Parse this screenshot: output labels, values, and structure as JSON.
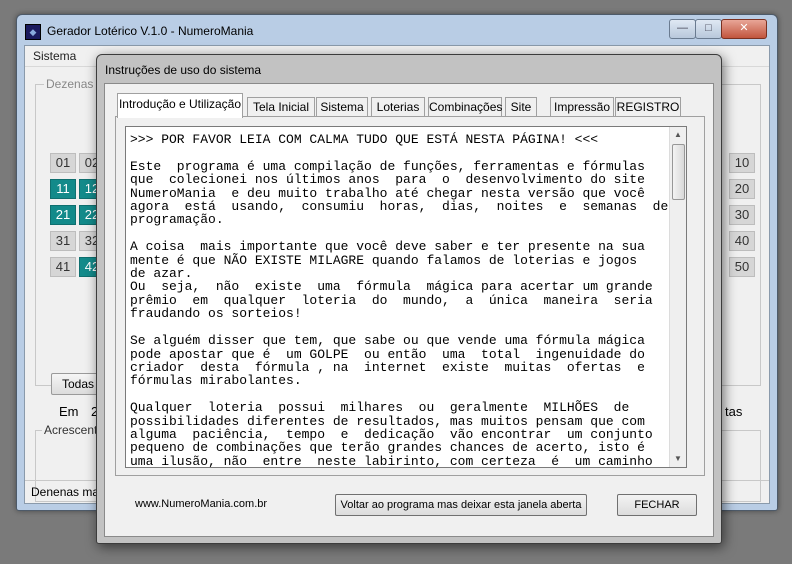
{
  "main_window": {
    "title": "Gerador Lotérico V.1.0 - NumeroMania",
    "menu": [
      "Sistema"
    ],
    "dezenas_label": "Dezenas p",
    "numbers_left": [
      {
        "n": "01",
        "sel": false
      },
      {
        "n": "02",
        "sel": false
      },
      {
        "n": "11",
        "sel": true
      },
      {
        "n": "12",
        "sel": true
      },
      {
        "n": "21",
        "sel": true
      },
      {
        "n": "22",
        "sel": true
      },
      {
        "n": "31",
        "sel": false
      },
      {
        "n": "32",
        "sel": false
      },
      {
        "n": "41",
        "sel": false
      },
      {
        "n": "42",
        "sel": true
      }
    ],
    "numbers_right": [
      {
        "n": "10",
        "sel": false
      },
      {
        "n": "20",
        "sel": false
      },
      {
        "n": "30",
        "sel": false
      },
      {
        "n": "40",
        "sel": false
      },
      {
        "n": "50",
        "sel": false
      }
    ],
    "todas_button": "Todas",
    "em_label": "Em",
    "em_value": "24",
    "right_partial_label": "tas",
    "acresc_label": "Acrescent",
    "status_text": "Denenas ma",
    "colors": {
      "selected": "#138a8a",
      "unselected": "#d6d6d6"
    }
  },
  "dialog": {
    "title": "Instruções de uso do sistema",
    "tabs": [
      "Introdução e Utilização",
      "Tela Inicial",
      "Sistema",
      "Loterias",
      "Combinações",
      "Site",
      "Impressão",
      "REGISTRO"
    ],
    "active_tab": 0,
    "text": ">>> POR FAVOR LEIA COM CALMA TUDO QUE ESTÁ NESTA PÁGINA! <<<\n\nEste  programa é uma compilação de funções, ferramentas e fórmulas\nque  colecionei nos últimos anos  para  o  desenvolvimento do site\nNumeroMania  e deu muito trabalho até chegar nesta versão que você\nagora  está  usando,  consumiu  horas,  dias,  noites  e  semanas  de\nprogramação.\n\nA coisa  mais importante que você deve saber e ter presente na sua\nmente é que NÃO EXISTE MILAGRE quando falamos de loterias e jogos\nde azar.\nOu  seja,  não  existe  uma  fórmula  mágica para acertar um grande\nprêmio  em  qualquer  loteria  do  mundo,  a  única  maneira  seria\nfraudando os sorteios!\n\nSe alguém disser que tem, que sabe ou que vende uma fórmula mágica\npode apostar que é  um GOLPE  ou então  uma  total  ingenuidade do\ncriador  desta  fórmula , na  internet  existe  muitas  ofertas  e\nfórmulas mirabolantes.\n\nQualquer  loteria  possui  milhares  ou  geralmente  MILHÕES  de\npossibilidades diferentes de resultados, mas muitos pensam que com\nalguma  paciência,  tempo  e  dedicação  vão encontrar  um conjunto\npequeno de combinações que terão grandes chances de acerto, isto é\numa ilusão, não  entre  neste labirinto, com certeza  é  um caminho",
    "site_url": "www.NumeroMania.com.br",
    "btn_voltar": "Voltar ao programa mas deixar esta janela aberta",
    "btn_fechar": "FECHAR"
  }
}
